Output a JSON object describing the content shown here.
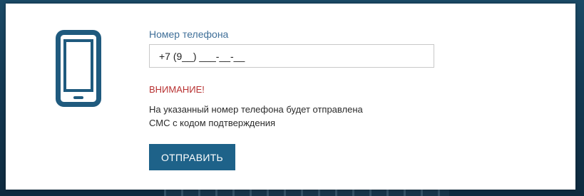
{
  "form": {
    "phone_label": "Номер телефона",
    "phone_value": "+7 (9__) ___-__-__",
    "warning_title": "ВНИМАНИЕ!",
    "warning_line1": "На указанный номер телефона будет отправлена",
    "warning_line2": "СМС с кодом подтверждения",
    "submit_label": "ОТПРАВИТЬ"
  },
  "icons": {
    "phone": "mobile-phone-icon"
  },
  "colors": {
    "accent": "#1e6289",
    "label": "#3f6f98",
    "warning": "#b83232",
    "icon": "#1f5a7e"
  }
}
